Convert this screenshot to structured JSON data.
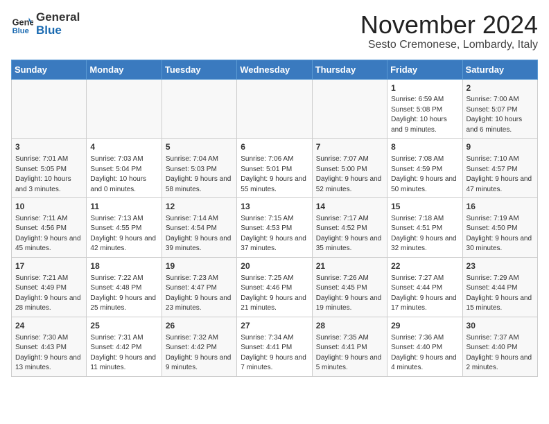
{
  "header": {
    "logo_general": "General",
    "logo_blue": "Blue",
    "month_title": "November 2024",
    "subtitle": "Sesto Cremonese, Lombardy, Italy"
  },
  "days_of_week": [
    "Sunday",
    "Monday",
    "Tuesday",
    "Wednesday",
    "Thursday",
    "Friday",
    "Saturday"
  ],
  "weeks": [
    [
      {
        "day": "",
        "info": ""
      },
      {
        "day": "",
        "info": ""
      },
      {
        "day": "",
        "info": ""
      },
      {
        "day": "",
        "info": ""
      },
      {
        "day": "",
        "info": ""
      },
      {
        "day": "1",
        "info": "Sunrise: 6:59 AM\nSunset: 5:08 PM\nDaylight: 10 hours and 9 minutes."
      },
      {
        "day": "2",
        "info": "Sunrise: 7:00 AM\nSunset: 5:07 PM\nDaylight: 10 hours and 6 minutes."
      }
    ],
    [
      {
        "day": "3",
        "info": "Sunrise: 7:01 AM\nSunset: 5:05 PM\nDaylight: 10 hours and 3 minutes."
      },
      {
        "day": "4",
        "info": "Sunrise: 7:03 AM\nSunset: 5:04 PM\nDaylight: 10 hours and 0 minutes."
      },
      {
        "day": "5",
        "info": "Sunrise: 7:04 AM\nSunset: 5:03 PM\nDaylight: 9 hours and 58 minutes."
      },
      {
        "day": "6",
        "info": "Sunrise: 7:06 AM\nSunset: 5:01 PM\nDaylight: 9 hours and 55 minutes."
      },
      {
        "day": "7",
        "info": "Sunrise: 7:07 AM\nSunset: 5:00 PM\nDaylight: 9 hours and 52 minutes."
      },
      {
        "day": "8",
        "info": "Sunrise: 7:08 AM\nSunset: 4:59 PM\nDaylight: 9 hours and 50 minutes."
      },
      {
        "day": "9",
        "info": "Sunrise: 7:10 AM\nSunset: 4:57 PM\nDaylight: 9 hours and 47 minutes."
      }
    ],
    [
      {
        "day": "10",
        "info": "Sunrise: 7:11 AM\nSunset: 4:56 PM\nDaylight: 9 hours and 45 minutes."
      },
      {
        "day": "11",
        "info": "Sunrise: 7:13 AM\nSunset: 4:55 PM\nDaylight: 9 hours and 42 minutes."
      },
      {
        "day": "12",
        "info": "Sunrise: 7:14 AM\nSunset: 4:54 PM\nDaylight: 9 hours and 39 minutes."
      },
      {
        "day": "13",
        "info": "Sunrise: 7:15 AM\nSunset: 4:53 PM\nDaylight: 9 hours and 37 minutes."
      },
      {
        "day": "14",
        "info": "Sunrise: 7:17 AM\nSunset: 4:52 PM\nDaylight: 9 hours and 35 minutes."
      },
      {
        "day": "15",
        "info": "Sunrise: 7:18 AM\nSunset: 4:51 PM\nDaylight: 9 hours and 32 minutes."
      },
      {
        "day": "16",
        "info": "Sunrise: 7:19 AM\nSunset: 4:50 PM\nDaylight: 9 hours and 30 minutes."
      }
    ],
    [
      {
        "day": "17",
        "info": "Sunrise: 7:21 AM\nSunset: 4:49 PM\nDaylight: 9 hours and 28 minutes."
      },
      {
        "day": "18",
        "info": "Sunrise: 7:22 AM\nSunset: 4:48 PM\nDaylight: 9 hours and 25 minutes."
      },
      {
        "day": "19",
        "info": "Sunrise: 7:23 AM\nSunset: 4:47 PM\nDaylight: 9 hours and 23 minutes."
      },
      {
        "day": "20",
        "info": "Sunrise: 7:25 AM\nSunset: 4:46 PM\nDaylight: 9 hours and 21 minutes."
      },
      {
        "day": "21",
        "info": "Sunrise: 7:26 AM\nSunset: 4:45 PM\nDaylight: 9 hours and 19 minutes."
      },
      {
        "day": "22",
        "info": "Sunrise: 7:27 AM\nSunset: 4:44 PM\nDaylight: 9 hours and 17 minutes."
      },
      {
        "day": "23",
        "info": "Sunrise: 7:29 AM\nSunset: 4:44 PM\nDaylight: 9 hours and 15 minutes."
      }
    ],
    [
      {
        "day": "24",
        "info": "Sunrise: 7:30 AM\nSunset: 4:43 PM\nDaylight: 9 hours and 13 minutes."
      },
      {
        "day": "25",
        "info": "Sunrise: 7:31 AM\nSunset: 4:42 PM\nDaylight: 9 hours and 11 minutes."
      },
      {
        "day": "26",
        "info": "Sunrise: 7:32 AM\nSunset: 4:42 PM\nDaylight: 9 hours and 9 minutes."
      },
      {
        "day": "27",
        "info": "Sunrise: 7:34 AM\nSunset: 4:41 PM\nDaylight: 9 hours and 7 minutes."
      },
      {
        "day": "28",
        "info": "Sunrise: 7:35 AM\nSunset: 4:41 PM\nDaylight: 9 hours and 5 minutes."
      },
      {
        "day": "29",
        "info": "Sunrise: 7:36 AM\nSunset: 4:40 PM\nDaylight: 9 hours and 4 minutes."
      },
      {
        "day": "30",
        "info": "Sunrise: 7:37 AM\nSunset: 4:40 PM\nDaylight: 9 hours and 2 minutes."
      }
    ]
  ]
}
